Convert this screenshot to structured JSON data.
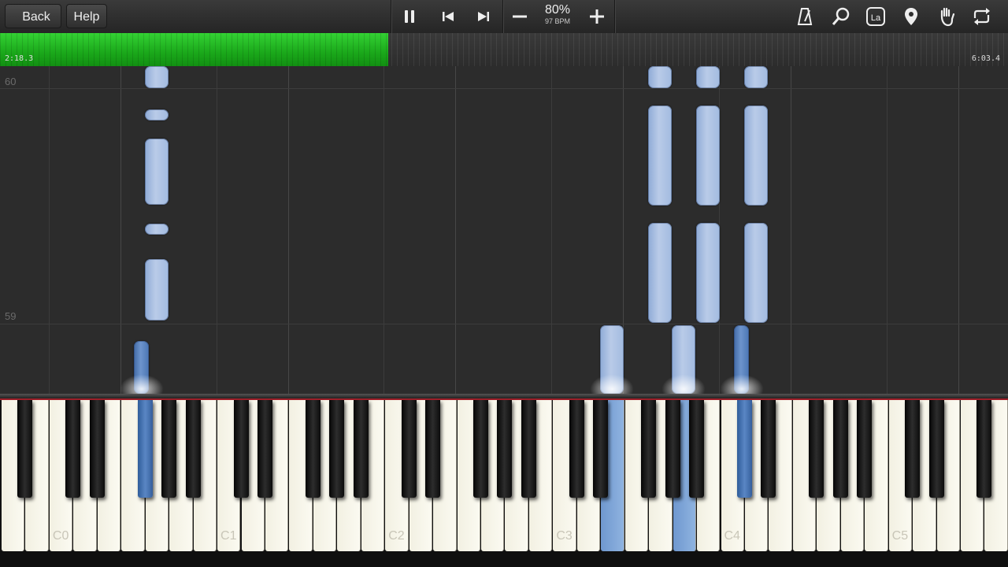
{
  "toolbar": {
    "back_label": "Back",
    "help_label": "Help",
    "tempo_percent": "80%",
    "tempo_bpm": "97 BPM",
    "icons": [
      "pause-icon",
      "skip-back-icon",
      "skip-forward-icon",
      "minus-icon",
      "plus-icon",
      "metronome-icon",
      "search-icon",
      "label-icon",
      "location-pin-icon",
      "hand-icon",
      "loop-icon"
    ],
    "label_icon_text": "La"
  },
  "progress": {
    "elapsed": "2:18.3",
    "total": "6:03.4",
    "fraction": 0.385,
    "fill_color": "#22b422"
  },
  "roll": {
    "measures": [
      "60",
      "59"
    ]
  },
  "keyboard": {
    "octave_labels": [
      "C0",
      "C1",
      "C2",
      "C3",
      "C4",
      "C5"
    ]
  },
  "colors": {
    "note_white": "#aec3e4",
    "note_black": "#5a84c0",
    "active_key": "#7aa3d8"
  }
}
